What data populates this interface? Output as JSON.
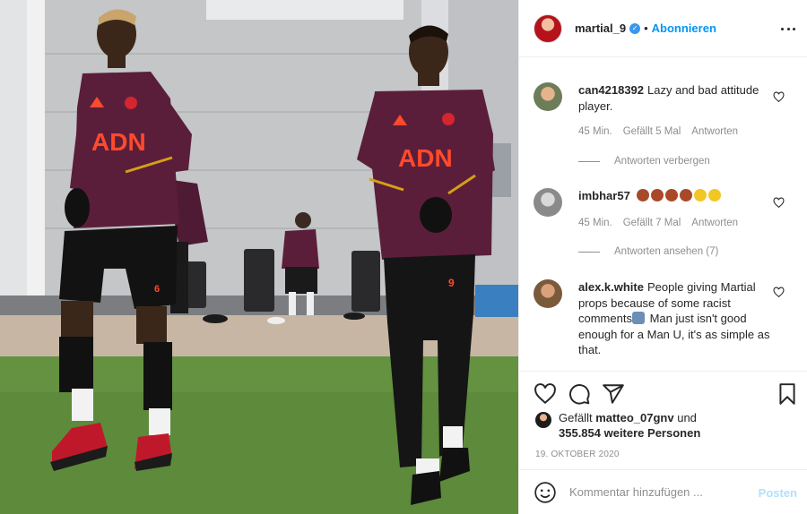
{
  "post": {
    "author": "martial_9",
    "verified_glyph": "✓",
    "separator": "•",
    "follow_label": "Abonnieren",
    "more_icon": "more-horizontal-icon"
  },
  "photo": {
    "sponsor_text": "ADN",
    "shirt_number_left": "6",
    "shirt_number_right": "9"
  },
  "comments": [
    {
      "username": "can4218392",
      "text": "Lazy and bad attitude player.",
      "time": "45 Min.",
      "likes": "Gefällt 5 Mal",
      "reply": "Antworten",
      "replies_toggle": "Antworten verbergen"
    },
    {
      "username": "imbhar57",
      "text": "",
      "emojis": [
        "fire-red-emoji",
        "fire-red-emoji",
        "fire-red-emoji",
        "fire-red-emoji",
        "face-emoji",
        "face-emoji"
      ],
      "time": "45 Min.",
      "likes": "Gefällt 7 Mal",
      "reply": "Antworten",
      "replies_toggle": "Antworten ansehen (7)"
    },
    {
      "username": "alex.k.white",
      "text": "People giving Martial props because of some racist comments",
      "emoji_mid": "person-shrugging-emoji",
      "text_after": " Man just isn't good enough for a Man U, it's as simple as that."
    }
  ],
  "actions": {
    "like_icon": "heart-icon",
    "comment_icon": "comment-icon",
    "share_icon": "send-icon",
    "save_icon": "bookmark-icon"
  },
  "likes": {
    "prefix": "Gefällt ",
    "user": "matteo_07gnv",
    "suffix": " und",
    "others": "355.854 weitere Personen"
  },
  "date": "19. Oktober 2020",
  "add_comment": {
    "placeholder": "Kommentar hinzufügen ...",
    "post_label": "Posten"
  },
  "colors": {
    "accent": "#0095f6",
    "post_disabled": "#b2dffc",
    "muted": "#8e8e8e",
    "kit": "#5b1e3a"
  }
}
